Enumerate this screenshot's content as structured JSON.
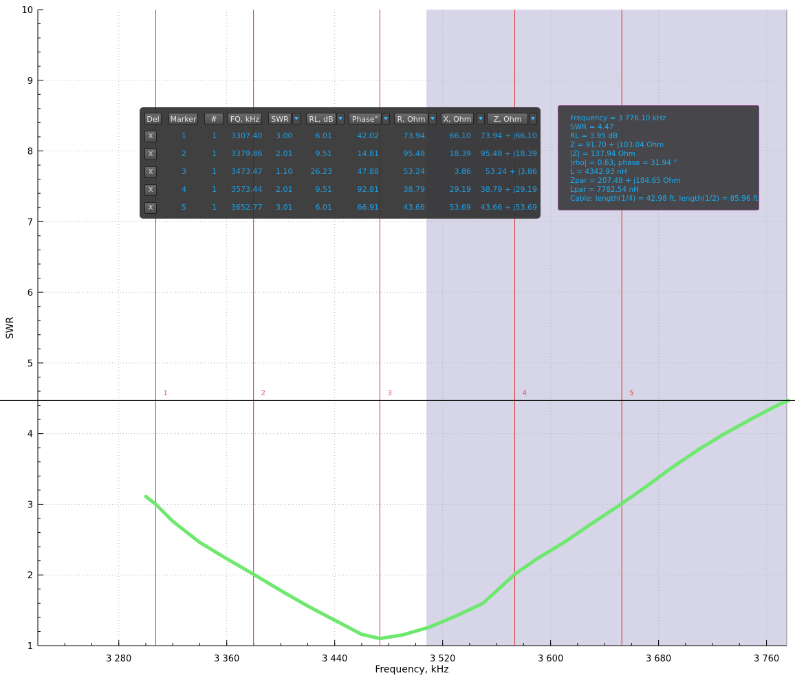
{
  "chart_data": {
    "type": "line",
    "xlabel": "Frequency, kHz",
    "ylabel": "SWR",
    "xlim": [
      3220,
      3775
    ],
    "ylim": [
      1,
      10
    ],
    "x_ticks": [
      3280,
      3360,
      3440,
      3520,
      3600,
      3680,
      3760
    ],
    "x_tick_labels": [
      "3 280",
      "3 360",
      "3 440",
      "3 520",
      "3 600",
      "3 680",
      "3 760"
    ],
    "y_ticks": [
      1,
      2,
      3,
      4,
      5,
      6,
      7,
      8,
      9,
      10
    ],
    "y_tick_labels": [
      "1",
      "2",
      "3",
      "4",
      "5",
      "6",
      "7",
      "8",
      "9",
      "10"
    ],
    "grid": true,
    "series_color": "#6ee86e",
    "shaded_region": {
      "from": 3508,
      "to": 3775,
      "color": "#d6d6e8"
    },
    "cursor_swr": 4.47,
    "series": [
      {
        "x": [
          3300,
          3307.4,
          3320,
          3340,
          3360,
          3379.86,
          3400,
          3420,
          3440,
          3460,
          3473.47,
          3490,
          3510,
          3530,
          3550,
          3573.44,
          3590,
          3610,
          3630,
          3652.77,
          3670,
          3690,
          3710,
          3730,
          3750,
          3770,
          3776.1
        ],
        "y": [
          3.11,
          3.0,
          2.76,
          2.46,
          2.23,
          2.01,
          1.78,
          1.56,
          1.36,
          1.16,
          1.1,
          1.15,
          1.26,
          1.42,
          1.6,
          2.01,
          2.23,
          2.46,
          2.72,
          3.01,
          3.24,
          3.52,
          3.78,
          4.01,
          4.22,
          4.42,
          4.47
        ]
      }
    ],
    "markers": [
      {
        "label": "1",
        "x": 3307.4
      },
      {
        "label": "2",
        "x": 3379.86
      },
      {
        "label": "3",
        "x": 3473.47
      },
      {
        "label": "4",
        "x": 3573.44
      },
      {
        "label": "5",
        "x": 3652.77
      }
    ]
  },
  "marker_table": {
    "headers": {
      "del": "Del",
      "marker": "Marker",
      "num": "#",
      "fq": "FQ, kHz",
      "swr": "SWR",
      "rl": "RL, dB",
      "phase": "Phase°",
      "r": "R, Ohm",
      "x": "X, Ohm",
      "z": "Z, Ohm"
    },
    "rows": [
      {
        "del": "X",
        "marker": "1",
        "num": "1",
        "fq": "3307.40",
        "swr": "3.00",
        "rl": "6.01",
        "phase": "42.02",
        "r": "73.94",
        "x": "66.10",
        "z": "73.94 + j66.10"
      },
      {
        "del": "X",
        "marker": "2",
        "num": "1",
        "fq": "3379.86",
        "swr": "2.01",
        "rl": "9.51",
        "phase": "14.81",
        "r": "95.48",
        "x": "18.39",
        "z": "95.48 + j18.39"
      },
      {
        "del": "X",
        "marker": "3",
        "num": "1",
        "fq": "3473.47",
        "swr": "1.10",
        "rl": "26.23",
        "phase": "47.88",
        "r": "53.24",
        "x": "3.86",
        "z": "53.24 + j3.86"
      },
      {
        "del": "X",
        "marker": "4",
        "num": "1",
        "fq": "3573.44",
        "swr": "2.01",
        "rl": "9.51",
        "phase": "92.81",
        "r": "38.79",
        "x": "29.19",
        "z": "38.79 + j29.19"
      },
      {
        "del": "X",
        "marker": "5",
        "num": "1",
        "fq": "3652.77",
        "swr": "3.01",
        "rl": "6.01",
        "phase": "66.91",
        "r": "43.66",
        "x": "53.69",
        "z": "43.66 + j53.69"
      }
    ]
  },
  "info": {
    "lines": [
      "Frequency = 3 776.10 kHz",
      "SWR = 4.47",
      "RL = 3.95 dB",
      "Z = 91.70 + j103.04 Ohm",
      "|Z| = 137.94 Ohm",
      "|rho| = 0.63, phase = 31.94 °",
      "L = 4342.93 nH",
      "Zpar = 207.48 + j184.65 Ohm",
      "Lpar = 7782.54 nH",
      "Cable: length(1/4) = 42.98 ft, length(1/2) = 85.96 ft"
    ]
  }
}
